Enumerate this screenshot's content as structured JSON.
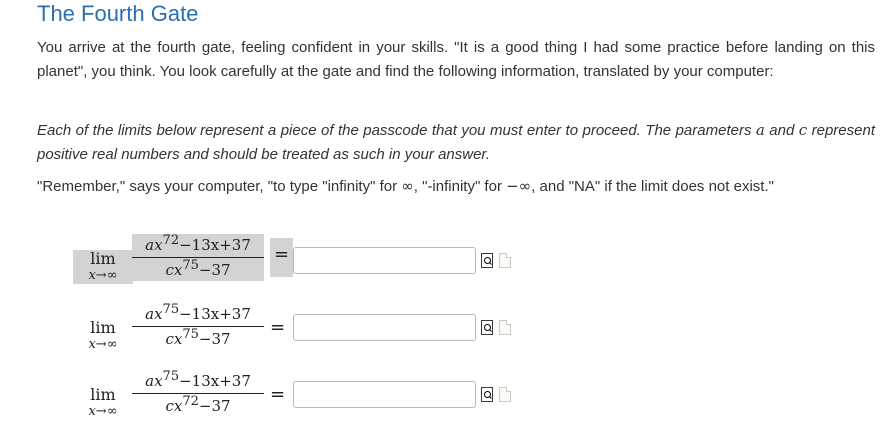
{
  "title": "The Fourth Gate",
  "intro": "You arrive at the fourth gate, feeling confident in your skills. \"It is a good thing I had some practice before landing on this planet\", you think. You look carefully at the gate and find the following information, translated by your computer:",
  "instructions": {
    "part1": "Each of the limits below represent a piece of the passcode that you must enter to proceed. The parameters ",
    "var_a": "a",
    "part2": " and ",
    "var_c": "c",
    "part3": " represent positive real numbers and should be treated as such in your answer."
  },
  "reminder": {
    "part1": "\"Remember,\" says your computer, \"to type \"infinity\" for ",
    "inf": "∞",
    "part2": ", \"-infinity\" for ",
    "neginf": "−∞",
    "part3": ", and \"NA\" if the limit does not exist.\""
  },
  "problems": [
    {
      "lim": "lim",
      "sub": "x→∞",
      "num": {
        "c": "a",
        "v": "x",
        "e": "72",
        "rest": "−13x+37"
      },
      "den": {
        "c": "c",
        "v": "x",
        "e": "75",
        "rest": "−37"
      },
      "eq": "=",
      "answer": ""
    },
    {
      "lim": "lim",
      "sub": "x→∞",
      "num": {
        "c": "a",
        "v": "x",
        "e": "75",
        "rest": "−13x+37"
      },
      "den": {
        "c": "c",
        "v": "x",
        "e": "75",
        "rest": "−37"
      },
      "eq": "=",
      "answer": ""
    },
    {
      "lim": "lim",
      "sub": "x→∞",
      "num": {
        "c": "a",
        "v": "x",
        "e": "75",
        "rest": "−13x+37"
      },
      "den": {
        "c": "c",
        "v": "x",
        "e": "72",
        "rest": "−37"
      },
      "eq": "=",
      "answer": ""
    }
  ],
  "icons": {
    "preview": "preview-icon",
    "help": "help-icon"
  },
  "colors": {
    "title": "#2a6fb4",
    "highlight": "#d3d3d3"
  }
}
